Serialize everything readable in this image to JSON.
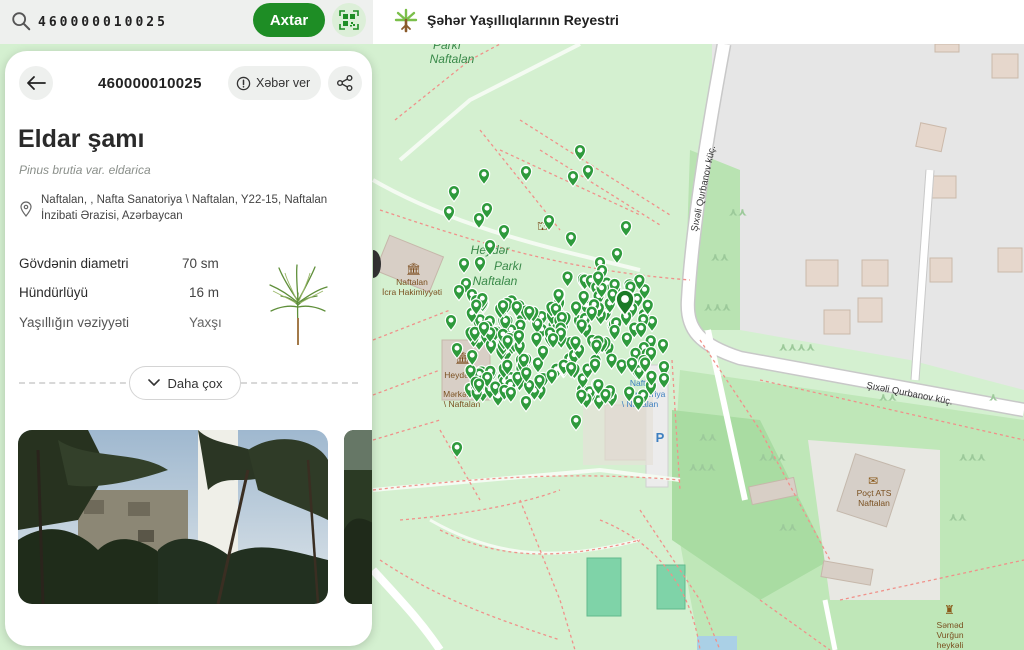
{
  "search": {
    "value": "460000010025",
    "placeholder": "",
    "button_label": "Axtar"
  },
  "header": {
    "title": "Şəhər Yaşıllıqlarının Reyestri"
  },
  "panel": {
    "tree_id": "460000010025",
    "report_label": "Xəbər ver",
    "name": "Eldar şamı",
    "latin_name": "Pinus brutia var. eldarica",
    "address": "Naftalan, , Nafta Sanatoriya \\ Naftalan, Y22-15, Naftalan İnzibati Ərazisi, Azərbaycan",
    "attributes": [
      {
        "label": "Gövdənin diametri",
        "value": "70 sm"
      },
      {
        "label": "Hündürlüyü",
        "value": "16 m"
      },
      {
        "label": "Yaşıllığın vəziyyəti",
        "value": "Yaxşı"
      }
    ],
    "more_label": "Daha çox"
  },
  "map": {
    "labels": {
      "park_top": [
        "Parkı",
        "Naftalan"
      ],
      "park_mid": [
        "Heydər",
        "Parkı",
        "Naftalan"
      ],
      "hakimiyyet": [
        "Naftalan",
        "İcra Hakimiyyəti"
      ],
      "muzey": [
        "Heydər",
        "Mərkəzi",
        "\\ Naftalan"
      ],
      "sanatoriya": [
        "Nafta",
        "Sanatoriya",
        "\\ Naftalan"
      ],
      "street_1": "Şıxəli Qurbanov küç.",
      "street_2": "Şıxəli Qurbanov küç.",
      "post": [
        "Poçt ATS",
        "Naftalan"
      ],
      "samad": [
        "Səməd",
        "Vurğun",
        "heykəli"
      ],
      "parking": "P"
    }
  },
  "colors": {
    "accent": "#1e8d25",
    "map_bg": "#d4f0d0",
    "pin": "#2e9a3c",
    "selected_pin": "#1c7a27"
  }
}
